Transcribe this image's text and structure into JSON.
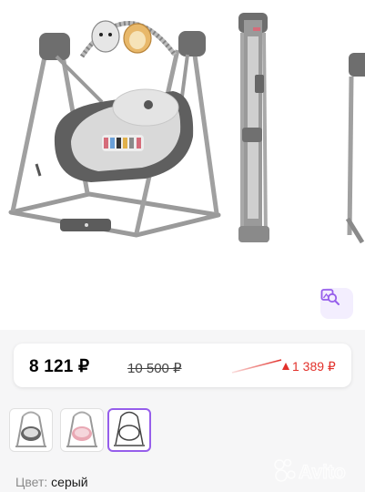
{
  "price": {
    "current": "8 121 ₽",
    "old": "10 500 ₽",
    "difference": "1 389 ₽",
    "difference_color": "#e2312b"
  },
  "gallery": {
    "zoom_icon": "image-zoom-icon",
    "accent": "#965eeb",
    "thumbnails": [
      {
        "name": "thumbnail-grey-swing",
        "selected": false
      },
      {
        "name": "thumbnail-pink-swing",
        "selected": false
      },
      {
        "name": "thumbnail-outline-swing",
        "selected": true
      }
    ]
  },
  "color": {
    "label": "Цвет:",
    "value": "серый"
  },
  "watermark": {
    "text": "Avito"
  }
}
